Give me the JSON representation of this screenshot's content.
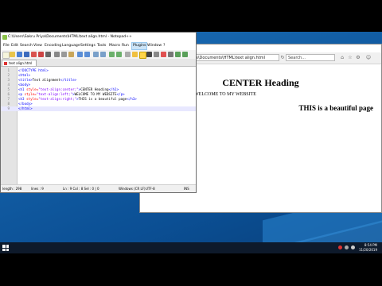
{
  "browser": {
    "address": "C:\\Users\\Documents\\HTML\\text align.html",
    "search_placeholder": "Search...",
    "heading": "CENTER Heading",
    "left_text": "WELCOME TO MY WEBSITE",
    "right_text": "THIS is a beautiful page"
  },
  "notepad": {
    "title": "C:\\Users\\Sakru Priya\\Documents\\HTML\\text align.html - Notepad++",
    "menus": [
      "File",
      "Edit",
      "Search",
      "View",
      "Encoding",
      "Language",
      "Settings",
      "Tools",
      "Macro",
      "Run",
      "Plugins",
      "Window",
      "?"
    ],
    "tab_label": "text align.html",
    "code_lines": [
      {
        "num": "1",
        "parts": [
          {
            "c": "tag",
            "t": "<!DOCTYPE html>"
          }
        ]
      },
      {
        "num": "2",
        "parts": [
          {
            "c": "tag",
            "t": "<html>"
          }
        ]
      },
      {
        "num": "3",
        "parts": [
          {
            "c": "tag",
            "t": "<title>"
          },
          {
            "c": "txt",
            "t": "Text alignment"
          },
          {
            "c": "tag",
            "t": "</title>"
          }
        ]
      },
      {
        "num": "4",
        "parts": [
          {
            "c": "tag",
            "t": "<body>"
          }
        ]
      },
      {
        "num": "5",
        "parts": [
          {
            "c": "tag",
            "t": "<h1 "
          },
          {
            "c": "attr",
            "t": "style="
          },
          {
            "c": "str",
            "t": "\"text-align:center;\""
          },
          {
            "c": "tag",
            "t": ">"
          },
          {
            "c": "txt",
            "t": "CENTER Heading"
          },
          {
            "c": "tag",
            "t": "</h1>"
          }
        ]
      },
      {
        "num": "6",
        "parts": [
          {
            "c": "tag",
            "t": "<p "
          },
          {
            "c": "attr",
            "t": "style="
          },
          {
            "c": "str",
            "t": "\"text-align:left;\""
          },
          {
            "c": "tag",
            "t": ">"
          },
          {
            "c": "txt",
            "t": "WELCOME TO MY WEBSITE"
          },
          {
            "c": "tag",
            "t": "</p>"
          }
        ]
      },
      {
        "num": "7",
        "parts": [
          {
            "c": "tag",
            "t": "<h3 "
          },
          {
            "c": "attr",
            "t": "style="
          },
          {
            "c": "str",
            "t": "\"text-align:right;\""
          },
          {
            "c": "tag",
            "t": ">"
          },
          {
            "c": "txt",
            "t": "THIS is a beautiful page"
          },
          {
            "c": "tag",
            "t": "</h3>"
          }
        ]
      },
      {
        "num": "8",
        "parts": [
          {
            "c": "tag",
            "t": "</body>"
          }
        ]
      },
      {
        "num": "9",
        "parts": [
          {
            "c": "tag",
            "t": "</html>"
          }
        ]
      }
    ],
    "status": {
      "length": "length : 298",
      "lines": "lines : 9",
      "position": "Ln : 9   Col : 8   Sel : 0 | 0",
      "eol": "Windows (CR LF)",
      "encoding": "UTF-8",
      "mode": "INS"
    }
  },
  "taskbar": {
    "time": "8:54 PM",
    "date": "11/20/2019"
  },
  "colors": {
    "desktop": "#0d5fa8",
    "taskbar": "#0e1a2b",
    "tag": "#0000ff",
    "attr": "#ff0000",
    "string": "#8000ff"
  }
}
